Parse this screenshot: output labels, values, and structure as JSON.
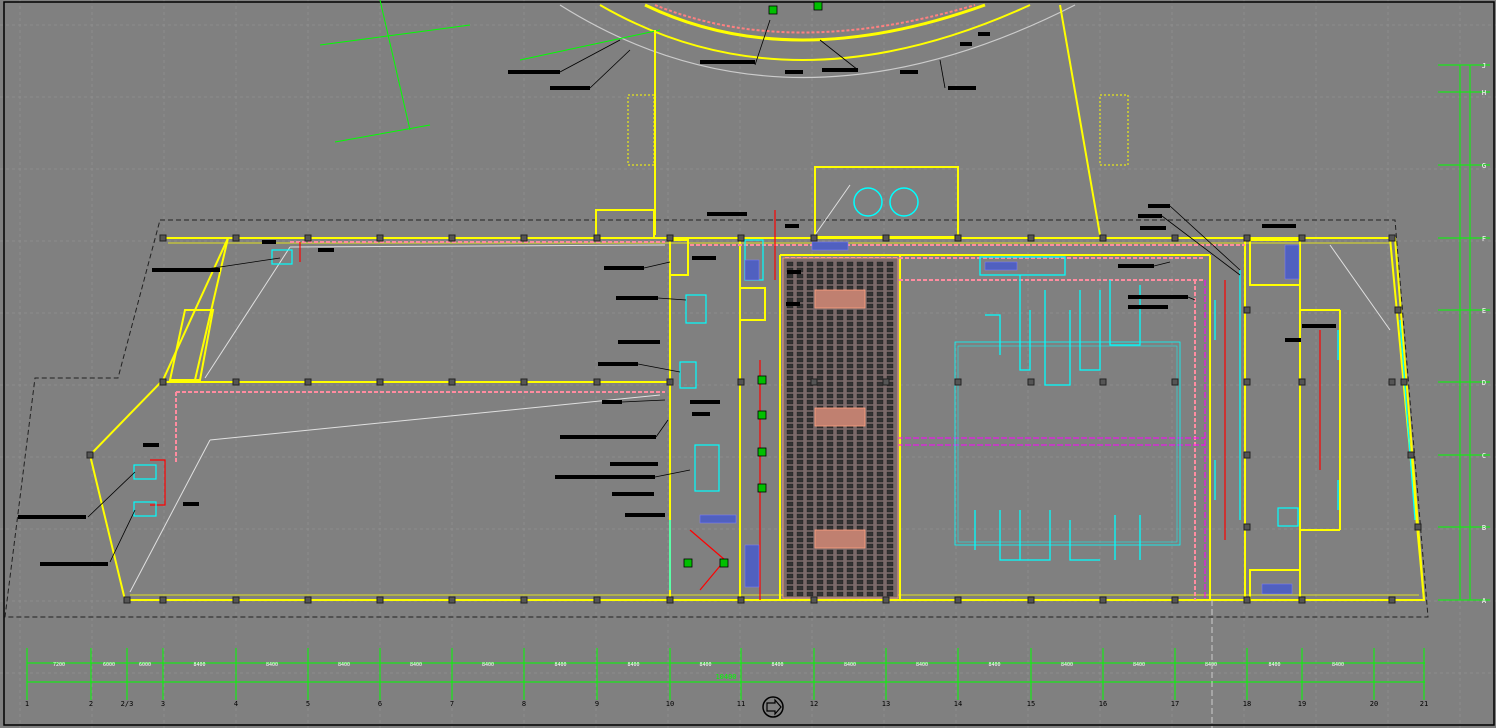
{
  "drawing": {
    "axis_bottom_labels": [
      "1",
      "2",
      "2/3",
      "3",
      "4",
      "5",
      "6",
      "7",
      "8",
      "9",
      "10",
      "11",
      "12",
      "13",
      "14",
      "15",
      "16",
      "17",
      "18",
      "19",
      "20",
      "21"
    ],
    "axis_right_labels": [
      "J",
      "H",
      "G",
      "F",
      "E",
      "D",
      "C",
      "B",
      "A"
    ],
    "overall_dimension": "10400",
    "bay_dimensions": [
      "7200",
      "6000",
      "6000",
      "8400",
      "8400",
      "8400",
      "8400",
      "8400",
      "8400",
      "8400",
      "8400",
      "8400",
      "8400",
      "8400",
      "8400",
      "8400",
      "8400",
      "8400",
      "8400",
      "8400"
    ],
    "colors": {
      "background": "#808080",
      "walls": "#ffff00",
      "grid": "#9a9a9a",
      "sprinkler_pipe": "#ff8080",
      "hydrant_pipe": "#ff0000",
      "equipment": "#00ffff",
      "dimension": "#00ff00",
      "seating": "#ffa080",
      "electrical": "#ff00ff"
    },
    "north_arrow_icon": "north-arrow-icon"
  }
}
